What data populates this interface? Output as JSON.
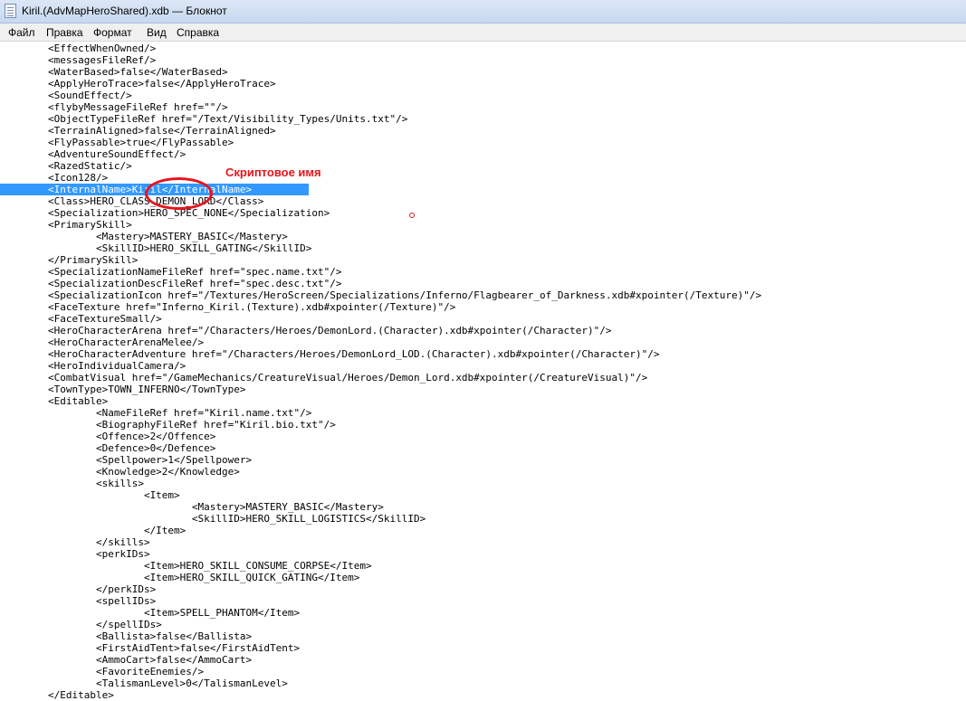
{
  "window": {
    "title": "Kiril.(AdvMapHeroShared).xdb — Блокнот"
  },
  "menu": {
    "file": "Файл",
    "edit": "Правка",
    "format": "Формат",
    "view": "Вид",
    "help": "Справка"
  },
  "annotation": {
    "label": "Скриптовое имя"
  },
  "editor": {
    "lines": [
      "        <EffectWhenOwned/>",
      "        <messagesFileRef/>",
      "        <WaterBased>false</WaterBased>",
      "        <ApplyHeroTrace>false</ApplyHeroTrace>",
      "        <SoundEffect/>",
      "        <flybyMessageFileRef href=\"\"/>",
      "        <ObjectTypeFileRef href=\"/Text/Visibility_Types/Units.txt\"/>",
      "        <TerrainAligned>false</TerrainAligned>",
      "        <FlyPassable>true</FlyPassable>",
      "        <AdventureSoundEffect/>",
      "        <RazedStatic/>",
      "        <Icon128/>",
      "        <InternalName>Kiril</InternalName>",
      "        <Class>HERO_CLASS_DEMON_LORD</Class>",
      "        <Specialization>HERO_SPEC_NONE</Specialization>",
      "        <PrimarySkill>",
      "                <Mastery>MASTERY_BASIC</Mastery>",
      "                <SkillID>HERO_SKILL_GATING</SkillID>",
      "        </PrimarySkill>",
      "        <SpecializationNameFileRef href=\"spec.name.txt\"/>",
      "        <SpecializationDescFileRef href=\"spec.desc.txt\"/>",
      "        <SpecializationIcon href=\"/Textures/HeroScreen/Specializations/Inferno/Flagbearer_of_Darkness.xdb#xpointer(/Texture)\"/>",
      "        <FaceTexture href=\"Inferno_Kiril.(Texture).xdb#xpointer(/Texture)\"/>",
      "        <FaceTextureSmall/>",
      "        <HeroCharacterArena href=\"/Characters/Heroes/DemonLord.(Character).xdb#xpointer(/Character)\"/>",
      "        <HeroCharacterArenaMelee/>",
      "        <HeroCharacterAdventure href=\"/Characters/Heroes/DemonLord_LOD.(Character).xdb#xpointer(/Character)\"/>",
      "        <HeroIndividualCamera/>",
      "        <CombatVisual href=\"/GameMechanics/CreatureVisual/Heroes/Demon_Lord.xdb#xpointer(/CreatureVisual)\"/>",
      "        <TownType>TOWN_INFERNO</TownType>",
      "        <Editable>",
      "                <NameFileRef href=\"Kiril.name.txt\"/>",
      "                <BiographyFileRef href=\"Kiril.bio.txt\"/>",
      "                <Offence>2</Offence>",
      "                <Defence>0</Defence>",
      "                <Spellpower>1</Spellpower>",
      "                <Knowledge>2</Knowledge>",
      "                <skills>",
      "                        <Item>",
      "                                <Mastery>MASTERY_BASIC</Mastery>",
      "                                <SkillID>HERO_SKILL_LOGISTICS</SkillID>",
      "                        </Item>",
      "                </skills>",
      "                <perkIDs>",
      "                        <Item>HERO_SKILL_CONSUME_CORPSE</Item>",
      "                        <Item>HERO_SKILL_QUICK_GATING</Item>",
      "                </perkIDs>",
      "                <spellIDs>",
      "                        <Item>SPELL_PHANTOM</Item>",
      "                </spellIDs>",
      "                <Ballista>false</Ballista>",
      "                <FirstAidTent>false</FirstAidTent>",
      "                <AmmoCart>false</AmmoCart>",
      "                <FavoriteEnemies/>",
      "                <TalismanLevel>0</TalismanLevel>",
      "        </Editable>"
    ],
    "selected_line_index": 12
  },
  "colors": {
    "selection": "#3399ff",
    "annotation": "#e8141b"
  }
}
